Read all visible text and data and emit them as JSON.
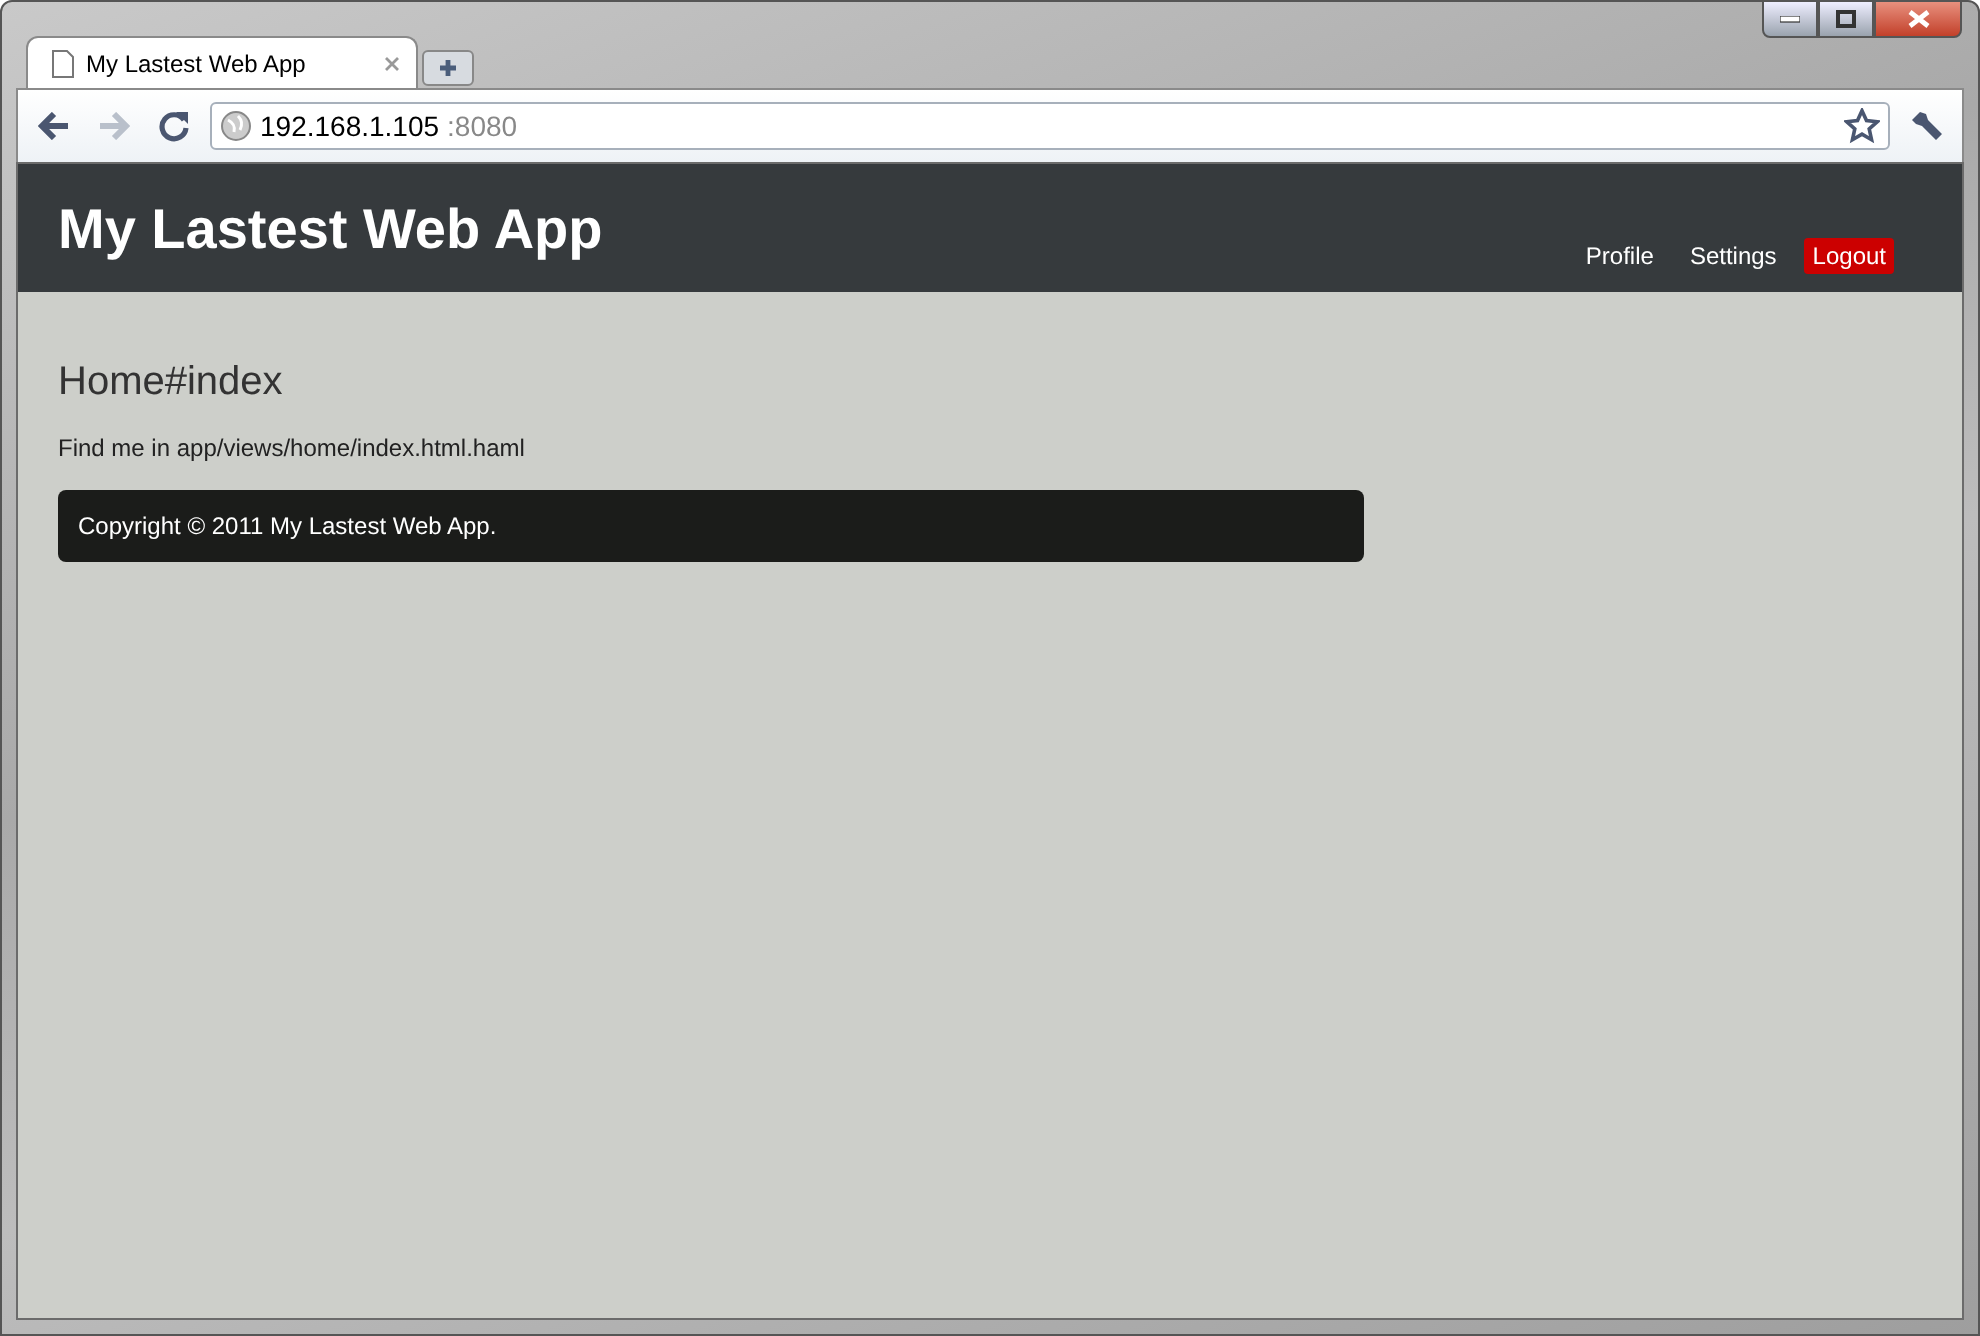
{
  "browser": {
    "tab": {
      "title": "My Lastest Web App",
      "selected": true
    },
    "address": {
      "host": "192.168.1.105",
      "port": ":8080"
    }
  },
  "header": {
    "brand": "My Lastest Web App",
    "nav": [
      {
        "label": "Profile",
        "highlighted": false
      },
      {
        "label": "Settings",
        "highlighted": false
      },
      {
        "label": "Logout",
        "highlighted": true
      }
    ]
  },
  "content": {
    "heading": "Home#index",
    "text": "Find me in app/views/home/index.html.haml"
  },
  "footer": {
    "text": "Copyright © 2011 My Lastest Web App."
  }
}
